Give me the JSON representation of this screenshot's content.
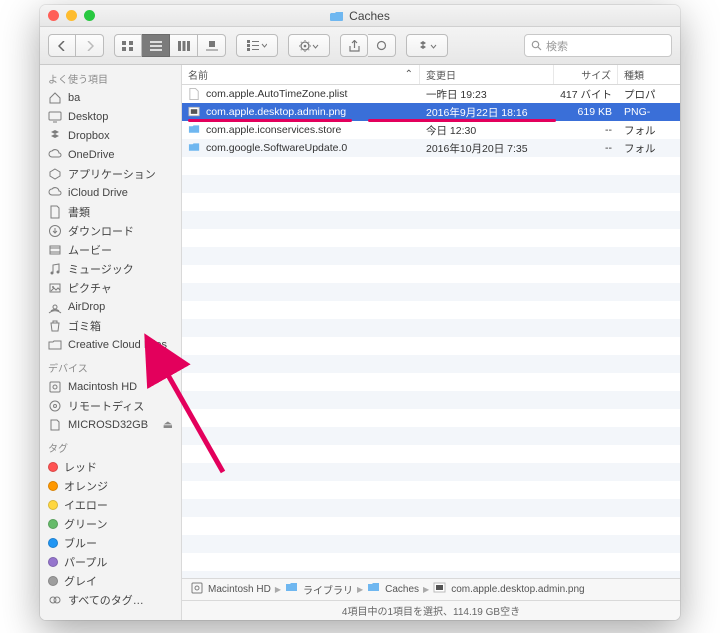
{
  "window": {
    "title": "Caches"
  },
  "search": {
    "placeholder": "検索"
  },
  "sidebar": {
    "sections": [
      {
        "heading": "よく使う項目",
        "items": [
          {
            "label": "ba",
            "icon": "home-icon"
          },
          {
            "label": "Desktop",
            "icon": "desktop-icon"
          },
          {
            "label": "Dropbox",
            "icon": "dropbox-icon"
          },
          {
            "label": "OneDrive",
            "icon": "cloud-icon"
          },
          {
            "label": "アプリケーション",
            "icon": "app-icon"
          },
          {
            "label": "iCloud Drive",
            "icon": "cloud-icon"
          },
          {
            "label": "書類",
            "icon": "doc-icon"
          },
          {
            "label": "ダウンロード",
            "icon": "download-icon"
          },
          {
            "label": "ムービー",
            "icon": "movie-icon"
          },
          {
            "label": "ミュージック",
            "icon": "music-icon"
          },
          {
            "label": "ピクチャ",
            "icon": "picture-icon"
          },
          {
            "label": "AirDrop",
            "icon": "airdrop-icon"
          },
          {
            "label": "ゴミ箱",
            "icon": "trash-icon"
          },
          {
            "label": "Creative Cloud Files",
            "icon": "folder-icon"
          }
        ]
      },
      {
        "heading": "デバイス",
        "items": [
          {
            "label": "Macintosh HD",
            "icon": "disk-icon"
          },
          {
            "label": "リモートディス",
            "icon": "optical-icon"
          },
          {
            "label": "MICROSD32GB",
            "icon": "sd-icon",
            "eject": true
          }
        ]
      },
      {
        "heading": "タグ",
        "items": [
          {
            "label": "レッド",
            "tag": "#ff5252"
          },
          {
            "label": "オレンジ",
            "tag": "#ff9800"
          },
          {
            "label": "イエロー",
            "tag": "#ffd740"
          },
          {
            "label": "グリーン",
            "tag": "#66bb6a"
          },
          {
            "label": "ブルー",
            "tag": "#2196f3"
          },
          {
            "label": "パープル",
            "tag": "#9575cd"
          },
          {
            "label": "グレイ",
            "tag": "#9e9e9e"
          },
          {
            "label": "すべてのタグ…",
            "icon": "alltags-icon"
          }
        ]
      }
    ]
  },
  "columns": {
    "name": "名前",
    "modified": "変更日",
    "size": "サイズ",
    "kind": "種類"
  },
  "files": [
    {
      "name": "com.apple.AutoTimeZone.plist",
      "modified": "一昨日 19:23",
      "size": "417 バイト",
      "kind": "プロパ",
      "icon": "doc-file-icon",
      "selected": false
    },
    {
      "name": "com.apple.desktop.admin.png",
      "modified": "2016年9月22日 18:16",
      "size": "619 KB",
      "kind": "PNG-",
      "icon": "png-file-icon",
      "selected": true
    },
    {
      "name": "com.apple.iconservices.store",
      "modified": "今日 12:30",
      "size": "--",
      "kind": "フォル",
      "icon": "folder-file-icon",
      "selected": false
    },
    {
      "name": "com.google.SoftwareUpdate.0",
      "modified": "2016年10月20日 7:35",
      "size": "--",
      "kind": "フォル",
      "icon": "folder-file-icon",
      "selected": false
    }
  ],
  "path": [
    {
      "label": "Macintosh HD",
      "icon": "disk-icon"
    },
    {
      "label": "ライブラリ",
      "icon": "folder-file-icon"
    },
    {
      "label": "Caches",
      "icon": "folder-file-icon"
    },
    {
      "label": "com.apple.desktop.admin.png",
      "icon": "png-file-icon"
    }
  ],
  "status": "4項目中の1項目を選択、114.19 GB空き"
}
